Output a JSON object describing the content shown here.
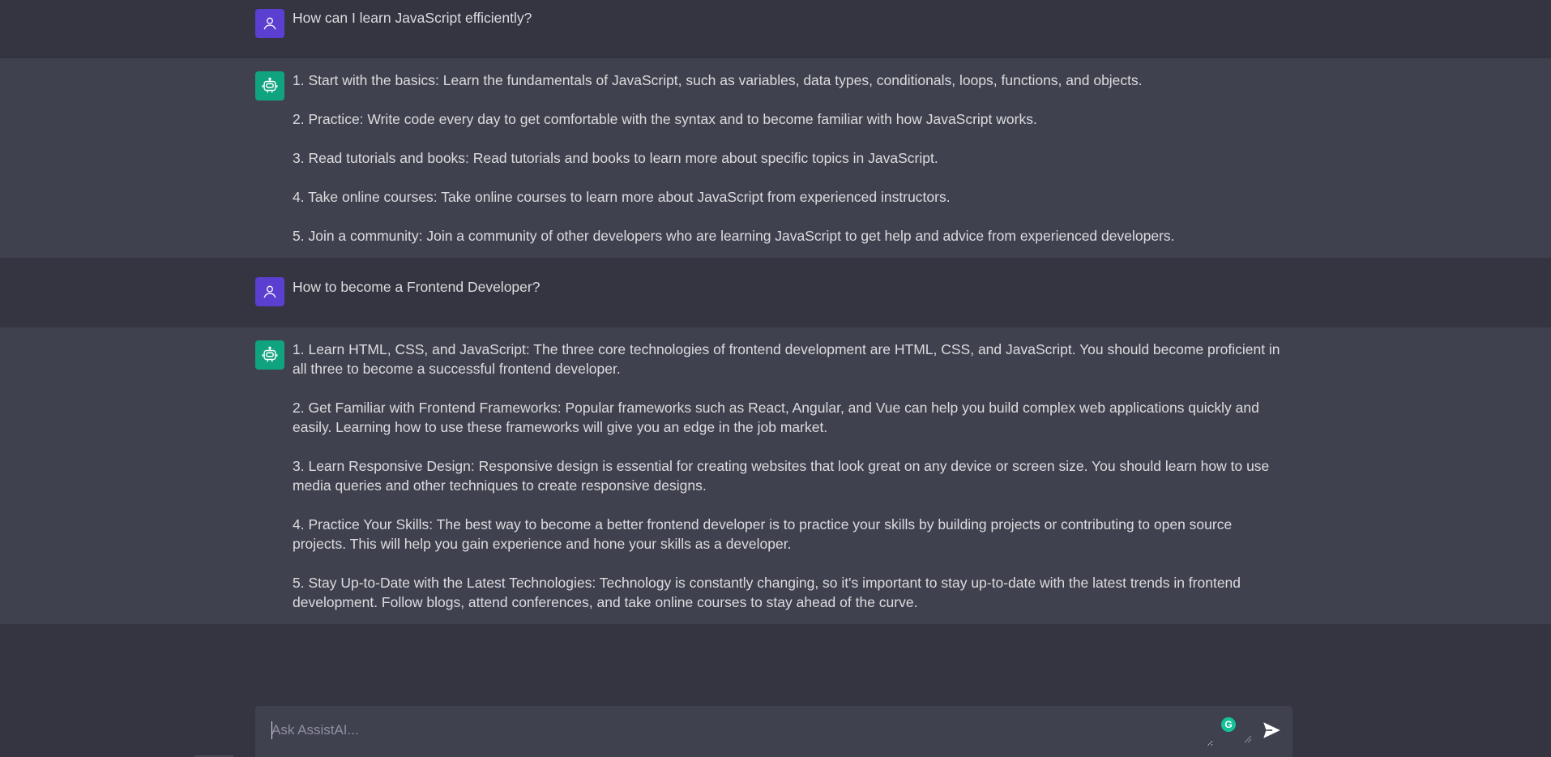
{
  "conversation": [
    {
      "role": "user",
      "text": "How can I learn JavaScript efficiently?"
    },
    {
      "role": "bot",
      "paragraphs": [
        "1. Start with the basics: Learn the fundamentals of JavaScript, such as variables, data types, conditionals, loops, functions, and objects.",
        "2. Practice: Write code every day to get comfortable with the syntax and to become familiar with how JavaScript works.",
        "3. Read tutorials and books: Read tutorials and books to learn more about specific topics in JavaScript.",
        "4. Take online courses: Take online courses to learn more about JavaScript from experienced instructors.",
        "5. Join a community: Join a community of other developers who are learning JavaScript to get help and advice from experienced developers."
      ]
    },
    {
      "role": "user",
      "text": "How to become a Frontend Developer?"
    },
    {
      "role": "bot",
      "paragraphs": [
        "1. Learn HTML, CSS, and JavaScript: The three core technologies of frontend development are HTML, CSS, and JavaScript. You should become proficient in all three to become a successful frontend developer.",
        "2. Get Familiar with Frontend Frameworks: Popular frameworks such as React, Angular, and Vue can help you build complex web applications quickly and easily. Learning how to use these frameworks will give you an edge in the job market.",
        "3. Learn Responsive Design: Responsive design is essential for creating websites that look great on any device or screen size. You should learn how to use media queries and other techniques to create responsive designs.",
        "4. Practice Your Skills: The best way to become a better frontend developer is to practice your skills by building projects or contributing to open source projects. This will help you gain experience and hone your skills as a developer.",
        "5. Stay Up-to-Date with the Latest Technologies: Technology is constantly changing, so it's important to stay up-to-date with the latest trends in frontend development. Follow blogs, attend conferences, and take online courses to stay ahead of the curve."
      ]
    }
  ],
  "composer": {
    "placeholder": "Ask AssistAI...",
    "value": "",
    "grammarly_letter": "G"
  },
  "icons": {
    "user_avatar": "user-icon",
    "bot_avatar": "robot-icon",
    "send": "send-icon",
    "grammarly": "grammarly-icon"
  },
  "colors": {
    "background": "#343541",
    "bot_background": "#40414f",
    "user_avatar": "#5b3fd1",
    "bot_avatar": "#10a37f",
    "text": "#dcdcde",
    "placeholder": "#8e8ea0",
    "grammarly": "#15c39a"
  }
}
